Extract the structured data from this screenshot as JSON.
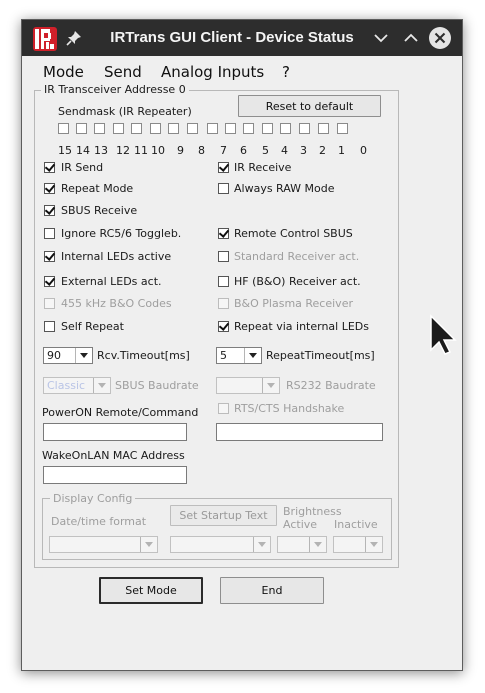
{
  "window": {
    "title": "IRTrans GUI Client - Device Status",
    "menu": [
      "Mode",
      "Send",
      "Analog Inputs",
      "?"
    ]
  },
  "transceiver_group": {
    "legend": "IR Transceiver Addresse 0",
    "sendmask_label": "Sendmask (IR Repeater)",
    "reset_button": "Reset to default",
    "sendmask_numbers": [
      "15",
      "14",
      "13",
      "12",
      "11",
      "10",
      "9",
      "8",
      "7",
      "6",
      "5",
      "4",
      "3",
      "2",
      "1",
      "0"
    ],
    "checkboxes": {
      "ir_send": {
        "label": "IR Send",
        "checked": true,
        "enabled": true
      },
      "ir_receive": {
        "label": "IR Receive",
        "checked": false,
        "enabled": true
      },
      "repeat_mode": {
        "label": "Repeat Mode",
        "checked": true,
        "enabled": true
      },
      "always_raw_mode": {
        "label": "Always RAW Mode",
        "checked": false,
        "enabled": true
      },
      "sbus_receive": {
        "label": "SBUS Receive",
        "checked": true,
        "enabled": true
      },
      "ignore_rc56": {
        "label": "Ignore RC5/6 Toggleb.",
        "checked": false,
        "enabled": true
      },
      "remote_control_sbus": {
        "label": "Remote Control SBUS",
        "checked": true,
        "enabled": true
      },
      "internal_leds_active": {
        "label": "Internal LEDs active",
        "checked": true,
        "enabled": true
      },
      "standard_receiver_act": {
        "label": "Standard Receiver act.",
        "checked": false,
        "enabled": false
      },
      "external_leds_act": {
        "label": "External LEDs act.",
        "checked": true,
        "enabled": true
      },
      "hf_bo_receiver_act": {
        "label": "HF (B&O) Receiver act.",
        "checked": false,
        "enabled": true
      },
      "bo_455khz_codes": {
        "label": "455 kHz B&O Codes",
        "checked": false,
        "enabled": false
      },
      "bo_plasma_receiver": {
        "label": "B&O Plasma Receiver",
        "checked": false,
        "enabled": false
      },
      "self_repeat": {
        "label": "Self Repeat",
        "checked": false,
        "enabled": true
      },
      "repeat_via_internal_leds": {
        "label": "Repeat via internal LEDs",
        "checked": true,
        "enabled": true
      },
      "rts_cts_handshake": {
        "label": "RTS/CTS  Handshake",
        "checked": false,
        "enabled": false
      }
    },
    "rcv_timeout": {
      "value": "90",
      "label": "Rcv.Timeout[ms]"
    },
    "repeat_timeout": {
      "value": "5",
      "label": "RepeatTimeout[ms]"
    },
    "sbus_baudrate": {
      "value": "Classic",
      "label": "SBUS Baudrate"
    },
    "rs232_baudrate": {
      "value": "",
      "label": "RS232 Baudrate"
    },
    "power_on_label": "PowerON Remote/Command",
    "power_on_value": "",
    "rs232_field_value": "",
    "wakeonlan_label": "WakeOnLAN MAC Address",
    "wakeonlan_value": ""
  },
  "display_config": {
    "legend": "Display Config",
    "datetime_label": "Date/time format",
    "startup_button": "Set Startup Text",
    "brightness_label": "Brightness",
    "active_label": "Active",
    "inactive_label": "Inactive"
  },
  "buttons": {
    "set_mode": "Set Mode",
    "end": "End"
  },
  "colors": {
    "titlebar": "#2d2d2d",
    "window_bg": "#efefef",
    "logo_red": "#d0202a"
  }
}
